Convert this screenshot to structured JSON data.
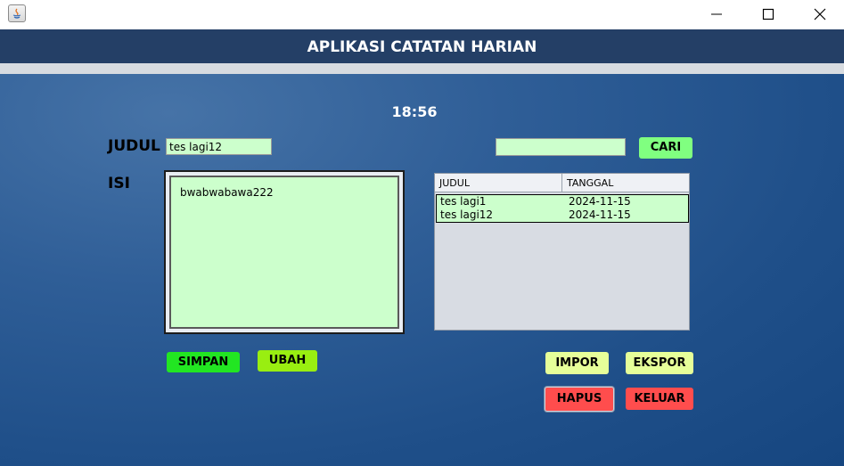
{
  "window": {
    "app_icon": "java-icon",
    "controls": [
      "minimize-icon",
      "maximize-icon",
      "close-icon"
    ]
  },
  "header": {
    "title": "APLIKASI CATATAN HARIAN"
  },
  "clock": "18:56",
  "form": {
    "judul_label": "JUDUL",
    "judul_value": "tes lagi12",
    "isi_label": "ISI",
    "isi_value": "bwabwabawa222",
    "search_value": ""
  },
  "buttons": {
    "cari": "CARI",
    "simpan": "SIMPAN",
    "ubah": "UBAH",
    "impor": "IMPOR",
    "ekspor": "EKSPOR",
    "hapus": "HAPUS",
    "keluar": "KELUAR"
  },
  "table": {
    "columns": [
      "JUDUL",
      "TANGGAL"
    ],
    "rows": [
      {
        "judul": "tes lagi1",
        "tanggal": "2024-11-15"
      },
      {
        "judul": "tes lagi12",
        "tanggal": "2024-11-15"
      }
    ]
  },
  "colors": {
    "header_bg": "#243f66",
    "input_bg": "#ccffcc",
    "btn_green": "#80ff80",
    "btn_simpan": "#22e622",
    "btn_ubah": "#99ee11",
    "btn_lime": "#e6ff99",
    "btn_red": "#ff4d4d"
  }
}
